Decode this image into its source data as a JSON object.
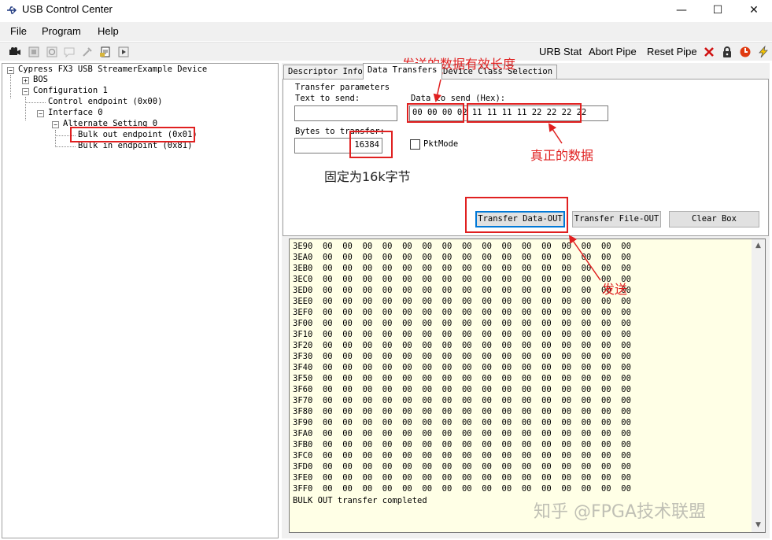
{
  "window": {
    "title": "USB Control Center",
    "minimize": "—",
    "maximize": "☐",
    "close": "✕"
  },
  "menu": [
    "File",
    "Program",
    "Help"
  ],
  "toolbar": {
    "urb_stat": "URB Stat",
    "abort_pipe": "Abort Pipe",
    "reset_pipe": "Reset Pipe"
  },
  "tree": {
    "device": "Cypress FX3 USB StreamerExample Device",
    "bos": "BOS",
    "configuration": "Configuration 1",
    "control_endpoint": "Control endpoint (0x00)",
    "interface": "Interface 0",
    "alt_setting": "Alternate Setting 0",
    "bulk_out": "Bulk out endpoint (0x01)",
    "bulk_in": "Bulk in endpoint (0x81)",
    "expand_plus": "+",
    "expand_minus": "−"
  },
  "tabs": [
    "Descriptor Info",
    "Data Transfers",
    "Device Class Selection"
  ],
  "transfer": {
    "params_label": "Transfer parameters",
    "text_to_send_label": "Text to send:",
    "text_to_send_value": "",
    "data_to_send_label": "Data to send (Hex):",
    "data_to_send_value": "00 00 00 02 11 11 11 11 22 22 22 22",
    "bytes_label": "Bytes to transfer:",
    "bytes_value": "16384",
    "pktmode_label": "PktMode",
    "btn_transfer_data": "Transfer Data-OUT",
    "btn_transfer_file": "Transfer File-OUT",
    "btn_clear": "Clear Box"
  },
  "output": {
    "zero_bytes": "00  00  00  00  00  00  00  00  00  00  00  00  00  00  00  00",
    "addresses": [
      "3E90",
      "3EA0",
      "3EB0",
      "3EC0",
      "3ED0",
      "3EE0",
      "3EF0",
      "3F00",
      "3F10",
      "3F20",
      "3F30",
      "3F40",
      "3F50",
      "3F60",
      "3F70",
      "3F80",
      "3F90",
      "3FA0",
      "3FB0",
      "3FC0",
      "3FD0",
      "3FE0",
      "3FF0"
    ],
    "status": "BULK OUT transfer completed",
    "scroll_up": "▲",
    "scroll_down": "▼"
  },
  "annotations": {
    "length_note": "发送的数据有效长度",
    "real_data_note": "真正的数据",
    "fixed_note": "固定为16k字节",
    "send_note": "发送"
  },
  "watermark": "知乎 @FPGA技术联盟",
  "colors": {
    "annotation_red": "#e02020",
    "focus_blue": "#0078d7",
    "output_bg": "#ffffe6"
  }
}
